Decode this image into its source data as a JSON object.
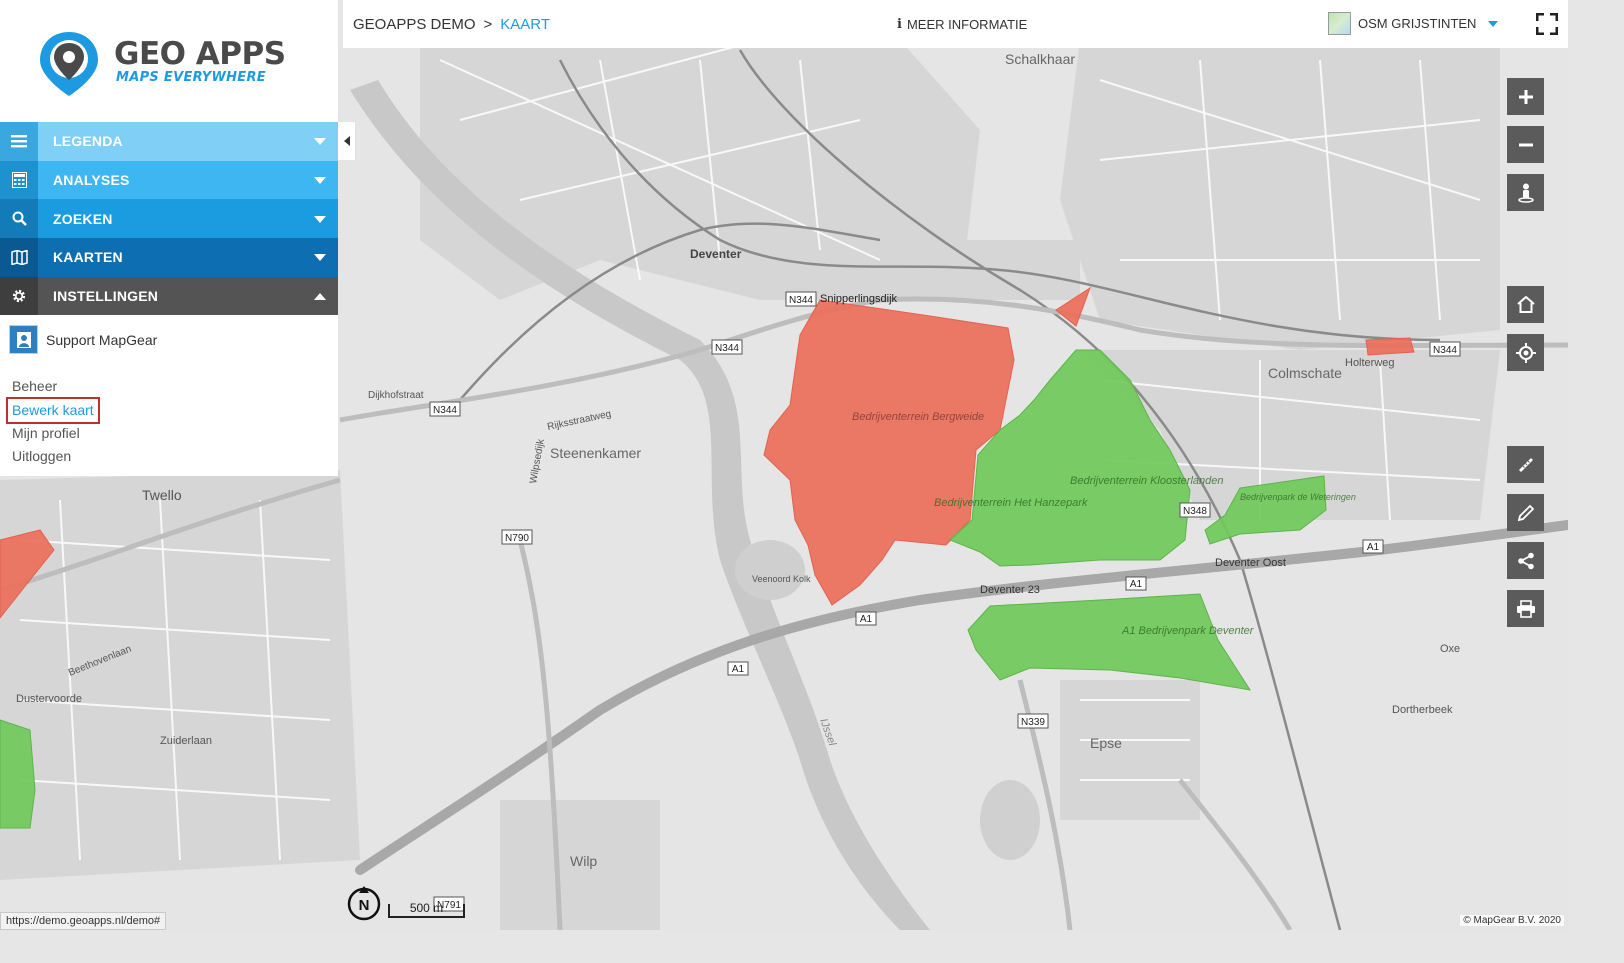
{
  "brand": {
    "title": "GEO APPS",
    "subtitle": "MAPS EVERYWHERE"
  },
  "menu": [
    {
      "label": "LEGENDA",
      "icon": "list-icon",
      "color": "#7fcff7"
    },
    {
      "label": "ANALYSES",
      "icon": "calculator-icon",
      "color": "#3db6f2"
    },
    {
      "label": "ZOEKEN",
      "icon": "search-icon",
      "color": "#1c9ce0"
    },
    {
      "label": "KAARTEN",
      "icon": "map-icon",
      "color": "#0d6fb2"
    },
    {
      "label": "INSTELLINGEN",
      "icon": "gear-icon",
      "color": "#545454"
    }
  ],
  "settings": {
    "support_label": "Support MapGear",
    "links": [
      "Beheer",
      "Bewerk kaart",
      "Mijn profiel",
      "Uitloggen"
    ]
  },
  "header": {
    "app": "GEOAPPS DEMO",
    "separator": ">",
    "page": "KAART",
    "info": "MEER INFORMATIE",
    "layer": "OSM GRIJSTINTEN"
  },
  "tools": [
    "zoom-in-icon",
    "zoom-out-icon",
    "streetview-icon",
    "home-icon",
    "locate-icon",
    "measure-icon",
    "edit-icon",
    "share-icon",
    "print-icon"
  ],
  "map": {
    "polygon_colors": {
      "red": "#ec6e5a",
      "green": "#6fc95a"
    },
    "labels": [
      "Schalkhaar",
      "Deventer",
      "Colmschate",
      "Steenenkamer",
      "Twello",
      "Epse",
      "Wilp",
      "Bedrijventerrein Bergweide",
      "Bedrijventerrein Het Hanzepark",
      "Bedrijventerrein Kloosterlanden",
      "A1 Bedrijvenpark Deventer",
      "Bedrijvenpark de Weteringen",
      "N344",
      "A1",
      "N348",
      "N790",
      "N339",
      "IJssel",
      "Snipperlingsdijk",
      "Holterweg",
      "Deventer Oost",
      "Deventer 23",
      "Veenoord Kolk",
      "Dortherbeek",
      "Oxe",
      "Dijkhofstraat",
      "Rijksstraatweg",
      "Wilpsedijk",
      "Zuiderlaan",
      "Dustervoorde",
      "Beethovenlaan",
      "N791"
    ]
  },
  "status_url": "https://demo.geoapps.nl/demo#",
  "scale_label": "500 m",
  "north_label": "N",
  "copyright": "© MapGear B.V. 2020"
}
